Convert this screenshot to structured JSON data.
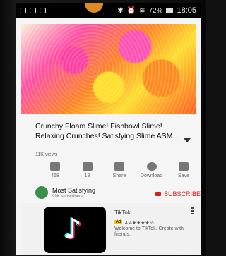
{
  "status_bar": {
    "battery": "72%",
    "time": "18:05"
  },
  "video": {
    "title": "Crunchy Floam Slime! Fishbowl Slime! Relaxing Crunches! Satisfying Slime ASM...",
    "views": "11K views"
  },
  "actions": [
    {
      "label": "468",
      "icon": "thumbs-up-icon"
    },
    {
      "label": "18",
      "icon": "thumbs-down-icon"
    },
    {
      "label": "Share",
      "icon": "share-icon"
    },
    {
      "label": "Download",
      "icon": "download-icon"
    },
    {
      "label": "Save",
      "icon": "save-playlist-icon"
    }
  ],
  "channel": {
    "name": "Most Satisfying",
    "subscribers": "99K subscribers",
    "subscribe_label": "SUBSCRIBE"
  },
  "ad": {
    "app_name": "TikTok",
    "badge": "Ad",
    "rating": "4.4★★★★½",
    "description": "Welcome to TikTok. Create with friends."
  },
  "colors": {
    "accent_red": "#d62020",
    "ad_badge": "#f3c318"
  }
}
